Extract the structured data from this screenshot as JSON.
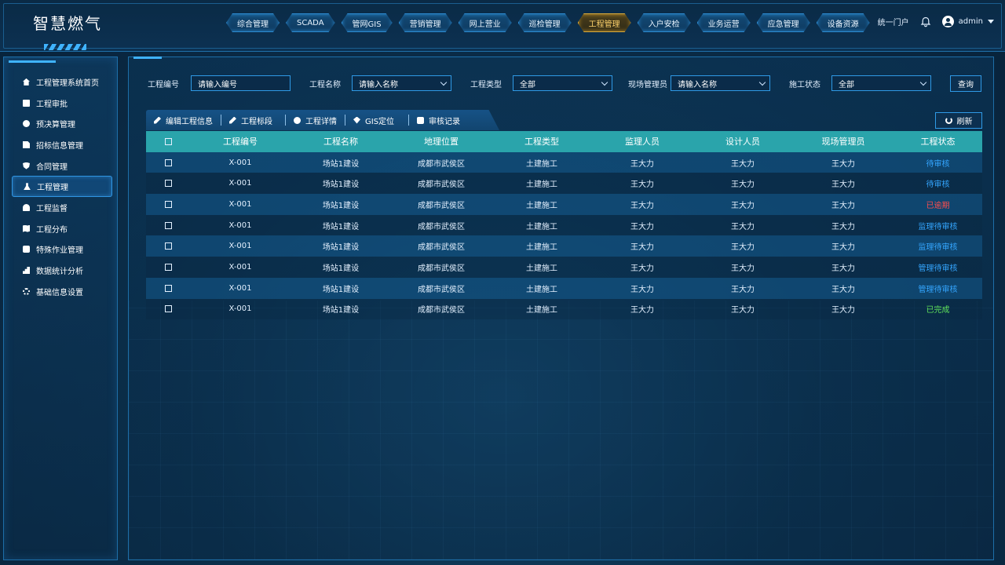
{
  "app": {
    "title": "智慧燃气"
  },
  "nav": [
    {
      "label": "综合管理"
    },
    {
      "label": "SCADA"
    },
    {
      "label": "管网GIS"
    },
    {
      "label": "营销管理"
    },
    {
      "label": "网上营业"
    },
    {
      "label": "巡检管理"
    },
    {
      "label": "工程管理",
      "active": true
    },
    {
      "label": "入户安检"
    },
    {
      "label": "业务运营"
    },
    {
      "label": "应急管理"
    },
    {
      "label": "设备资源"
    }
  ],
  "header_right": {
    "portal": "统一门户",
    "user": "admin"
  },
  "sidebar": [
    {
      "label": "工程管理系统首页",
      "icon": "home-icon"
    },
    {
      "label": "工程审批",
      "icon": "monitor-icon"
    },
    {
      "label": "预决算管理",
      "icon": "search-icon"
    },
    {
      "label": "招标信息管理",
      "icon": "document-icon"
    },
    {
      "label": "合同管理",
      "icon": "shield-icon"
    },
    {
      "label": "工程管理",
      "icon": "worker-icon",
      "active": true
    },
    {
      "label": "工程监督",
      "icon": "eye-icon"
    },
    {
      "label": "工程分布",
      "icon": "map-icon"
    },
    {
      "label": "特殊作业管理",
      "icon": "box-icon"
    },
    {
      "label": "数据统计分析",
      "icon": "chart-icon"
    },
    {
      "label": "基础信息设置",
      "icon": "gear-icon"
    }
  ],
  "filters": {
    "code_label": "工程编号",
    "code_placeholder": "请输入编号",
    "name_label": "工程名称",
    "name_value": "请输入名称",
    "type_label": "工程类型",
    "type_value": "全部",
    "manager_label": "现场管理员",
    "manager_value": "请输入名称",
    "status_label": "施工状态",
    "status_value": "全部",
    "query_button": "查询"
  },
  "toolbar": {
    "edit": "编辑工程信息",
    "bid": "工程标段",
    "detail": "工程详情",
    "gis": "GIS定位",
    "audit": "审核记录",
    "refresh": "刷新"
  },
  "table": {
    "headers": [
      "工程编号",
      "工程名称",
      "地理位置",
      "工程类型",
      "监理人员",
      "设计人员",
      "现场管理员",
      "工程状态"
    ],
    "rows": [
      {
        "code": "X-001",
        "name": "场站1建设",
        "location": "成都市武侯区",
        "type": "土建施工",
        "supervisor": "王大力",
        "designer": "王大力",
        "manager": "王大力",
        "status": "待审核"
      },
      {
        "code": "X-001",
        "name": "场站1建设",
        "location": "成都市武侯区",
        "type": "土建施工",
        "supervisor": "王大力",
        "designer": "王大力",
        "manager": "王大力",
        "status": "待审核"
      },
      {
        "code": "X-001",
        "name": "场站1建设",
        "location": "成都市武侯区",
        "type": "土建施工",
        "supervisor": "王大力",
        "designer": "王大力",
        "manager": "王大力",
        "status": "已逾期"
      },
      {
        "code": "X-001",
        "name": "场站1建设",
        "location": "成都市武侯区",
        "type": "土建施工",
        "supervisor": "王大力",
        "designer": "王大力",
        "manager": "王大力",
        "status": "监理待审核"
      },
      {
        "code": "X-001",
        "name": "场站1建设",
        "location": "成都市武侯区",
        "type": "土建施工",
        "supervisor": "王大力",
        "designer": "王大力",
        "manager": "王大力",
        "status": "监理待审核"
      },
      {
        "code": "X-001",
        "name": "场站1建设",
        "location": "成都市武侯区",
        "type": "土建施工",
        "supervisor": "王大力",
        "designer": "王大力",
        "manager": "王大力",
        "status": "管理待审核"
      },
      {
        "code": "X-001",
        "name": "场站1建设",
        "location": "成都市武侯区",
        "type": "土建施工",
        "supervisor": "王大力",
        "designer": "王大力",
        "manager": "王大力",
        "status": "管理待审核"
      },
      {
        "code": "X-001",
        "name": "场站1建设",
        "location": "成都市武侯区",
        "type": "土建施工",
        "supervisor": "王大力",
        "designer": "王大力",
        "manager": "王大力",
        "status": "已完成"
      }
    ]
  },
  "colors": {
    "accent": "#2f9ae6",
    "header_row": "#2aa4ab",
    "active_nav": "#ffd36b",
    "status_blue": "#34a6ff",
    "status_red": "#ff4d4d",
    "status_green": "#5fe15a"
  }
}
